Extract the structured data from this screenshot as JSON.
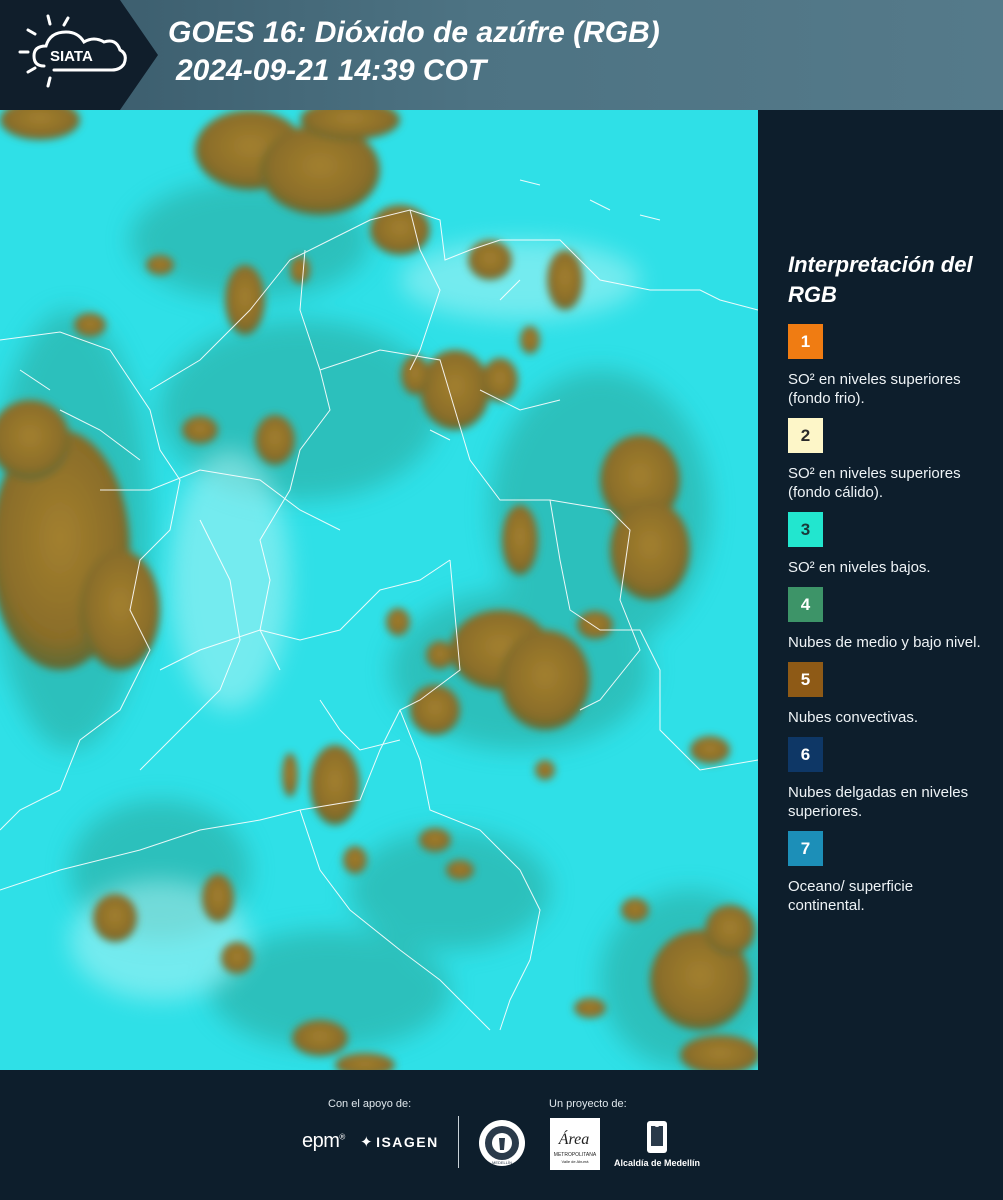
{
  "header": {
    "logo_text": "SIATA",
    "title_line1": "GOES 16: Dióxido de azúfre (RGB)",
    "title_line2": "2024-09-21 14:39 COT"
  },
  "map": {
    "description_icon": "satellite-map",
    "background_color": "#2ee0e6",
    "cloud_color": "#9a7a2c",
    "border_color": "#ffffff"
  },
  "legend": {
    "title": "Interpretación del RGB",
    "items": [
      {
        "number": "1",
        "color": "#f07c12",
        "text_color": "#ffffff",
        "label": "SO² en niveles superiores (fondo frio)."
      },
      {
        "number": "2",
        "color": "#fdf6c8",
        "text_color": "#2a2a2a",
        "label": "SO² en niveles superiores (fondo cálido)."
      },
      {
        "number": "3",
        "color": "#22e6cf",
        "text_color": "#1a3a3a",
        "label": "SO² en niveles bajos."
      },
      {
        "number": "4",
        "color": "#3d9468",
        "text_color": "#ffffff",
        "label": "Nubes de medio y bajo nivel."
      },
      {
        "number": "5",
        "color": "#8e5a16",
        "text_color": "#ffffff",
        "label": "Nubes convectivas."
      },
      {
        "number": "6",
        "color": "#0e3766",
        "text_color": "#ffffff",
        "label": "Nubes delgadas en niveles superiores."
      },
      {
        "number": "7",
        "color": "#1c8fb8",
        "text_color": "#ffffff",
        "label": "Oceano/ superficie continental."
      }
    ]
  },
  "footer": {
    "support_label": "Con el apoyo de:",
    "project_label": "Un proyecto de:",
    "epm": "epm",
    "isagen": "ISAGEN",
    "area_metropolitana": "Área",
    "area_sub": "METROPOLITANA",
    "area_sub2": "Valle de Aburrá",
    "alcaldia": "Alcaldía de Medellín",
    "seal_text": "MEDELLÍN"
  }
}
